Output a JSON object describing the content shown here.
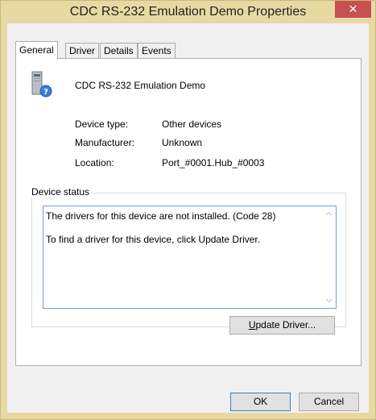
{
  "window": {
    "title": "CDC RS-232 Emulation Demo Properties",
    "close_glyph": "✕"
  },
  "tabs": [
    {
      "label": "General",
      "active": true
    },
    {
      "label": "Driver",
      "active": false
    },
    {
      "label": "Details",
      "active": false
    },
    {
      "label": "Events",
      "active": false
    }
  ],
  "device": {
    "name": "CDC RS-232 Emulation Demo",
    "icon": "unknown-device-icon"
  },
  "properties": [
    {
      "label": "Device type:",
      "value": "Other devices"
    },
    {
      "label": "Manufacturer:",
      "value": "Unknown"
    },
    {
      "label": "Location:",
      "value": "Port_#0001.Hub_#0003"
    }
  ],
  "device_status": {
    "title": "Device status",
    "line1": "The drivers for this device are not installed. (Code 28)",
    "line2": "To find a driver for this device, click Update Driver."
  },
  "buttons": {
    "update_driver_mnemonic": "U",
    "update_driver_rest": "pdate Driver...",
    "ok": "OK",
    "cancel": "Cancel"
  },
  "colors": {
    "title_bar": "#e8d9a3",
    "close_button": "#c75050",
    "status_border": "#7a9cd3"
  }
}
